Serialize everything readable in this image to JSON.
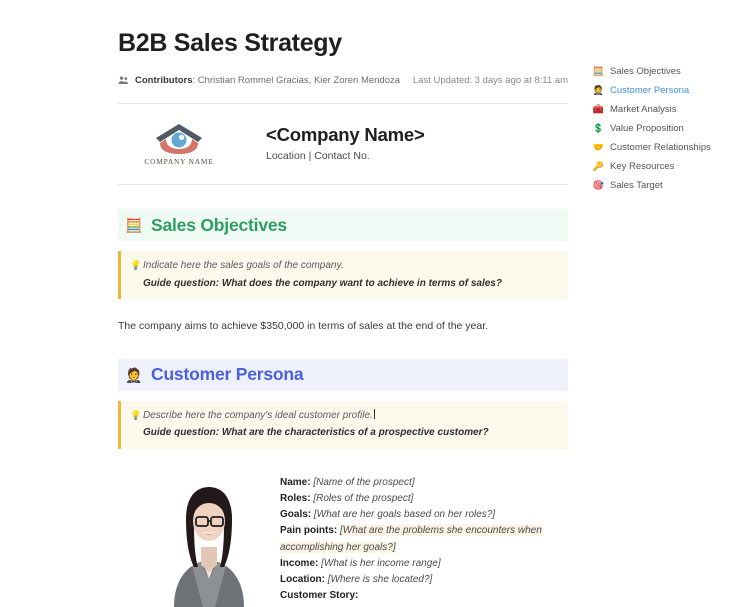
{
  "header": {
    "title": "B2B Sales Strategy",
    "contributors_icon": "people-icon",
    "contributors_label": "Contributors",
    "contributors_names": ": Christian Rommel Gracias, Kier Zoren Mendoza",
    "last_updated": "Last Updated: 3 days ago at 8:11 am"
  },
  "company": {
    "logo_caption": "COMPANY NAME",
    "logo_icon": "house-logo-icon",
    "name": "<Company Name>",
    "subtitle": "Location | Contact No."
  },
  "sections": [
    {
      "id": "sales-objectives",
      "icon": "abacus-icon",
      "emoji": "🧮",
      "title": "Sales Objectives",
      "accent": "#2e9e63",
      "header_bg": "#eefaf3",
      "callout": {
        "bulb_icon": "lightbulb-icon",
        "instruction": "Indicate here the sales goals of the company.",
        "guide_question": "Guide question: What does the company want to achieve in terms of sales?",
        "has_caret": false
      },
      "answer": "The company aims to achieve $350,000 in terms of sales at the end of the year."
    },
    {
      "id": "customer-persona",
      "icon": "person-in-suit-icon",
      "emoji": "🤵",
      "title": "Customer Persona",
      "accent": "#4a62d6",
      "header_bg": "#eef0fc",
      "callout": {
        "bulb_icon": "lightbulb-icon",
        "instruction": "Describe here the company's ideal customer profile.",
        "guide_question": "Guide question: What are the characteristics of a prospective customer?",
        "has_caret": true
      }
    }
  ],
  "persona": {
    "photo_alt": "persona-photo",
    "fields": [
      {
        "label": "Name:",
        "value": "[Name of the prospect]",
        "highlight": false,
        "wrap": false
      },
      {
        "label": "Roles:",
        "value": "[Roles of the prospect]",
        "highlight": false,
        "wrap": false
      },
      {
        "label": "Goals:",
        "value": "[What are her goals based on her roles?]",
        "highlight": false,
        "wrap": false
      },
      {
        "label": "Pain points:",
        "value": "[What are the problems she encounters when accomplishing her goals?]",
        "highlight": true,
        "wrap": true
      },
      {
        "label": "Income:",
        "value": "[What is her income range]",
        "highlight": false,
        "wrap": false
      },
      {
        "label": "Location:",
        "value": "[Where is she located?]",
        "highlight": false,
        "wrap": false
      },
      {
        "label": "Customer Story:",
        "value": "",
        "highlight": false,
        "wrap": false
      }
    ]
  },
  "rail": {
    "items": [
      {
        "icon": "abacus-icon",
        "emoji": "🧮",
        "label": "Sales Objectives",
        "active": false
      },
      {
        "icon": "person-in-suit-icon",
        "emoji": "🤵",
        "label": "Customer Persona",
        "active": true
      },
      {
        "icon": "toolbox-icon",
        "emoji": "🧰",
        "label": "Market Analysis",
        "active": false
      },
      {
        "icon": "dollar-icon",
        "emoji": "💲",
        "label": "Value Proposition",
        "active": false
      },
      {
        "icon": "handshake-icon",
        "emoji": "🤝",
        "label": "Customer Relationships",
        "active": false
      },
      {
        "icon": "key-icon",
        "emoji": "🔑",
        "label": "Key Resources",
        "active": false
      },
      {
        "icon": "dart-icon",
        "emoji": "🎯",
        "label": "Sales Target",
        "active": false
      }
    ]
  },
  "colors": {
    "green_accent": "#2e9e63",
    "blue_accent": "#4a62d6",
    "callout_border": "#e8b93a",
    "callout_bg": "#fdf8ec",
    "rail_active": "#3f8fe0"
  }
}
